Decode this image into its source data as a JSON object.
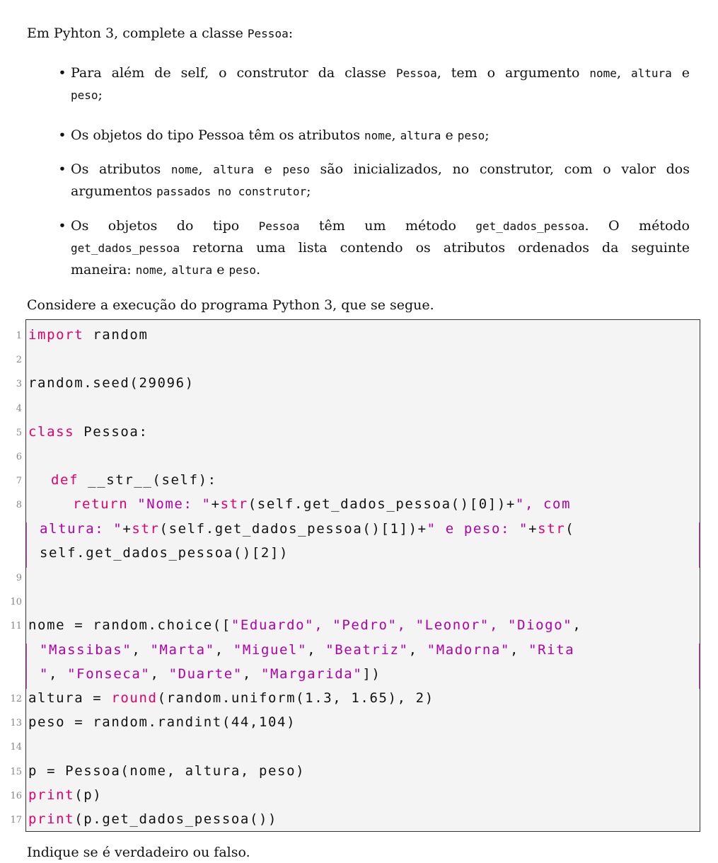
{
  "intro": {
    "text_before": "Em Pyhton 3, complete a classe ",
    "class_name": "Pessoa",
    "text_after": ":"
  },
  "bullets": [
    {
      "line1": [
        {
          "t": "Para além de self, o construtor da classe ",
          "m": false
        },
        {
          "t": "Pessoa",
          "m": true
        },
        {
          "t": ", tem o argumento ",
          "m": false
        },
        {
          "t": "nome",
          "m": true
        },
        {
          "t": ", ",
          "m": false
        },
        {
          "t": "altura",
          "m": true
        },
        {
          "t": " e",
          "m": false
        }
      ],
      "line2": [
        {
          "t": "peso",
          "m": true
        },
        {
          "t": ";",
          "m": false
        }
      ]
    },
    {
      "line1": [
        {
          "t": "Os objetos do tipo Pessoa têm os atributos ",
          "m": false
        },
        {
          "t": "nome",
          "m": true
        },
        {
          "t": ", ",
          "m": false
        },
        {
          "t": "altura",
          "m": true
        },
        {
          "t": " e ",
          "m": false
        },
        {
          "t": "peso",
          "m": true
        },
        {
          "t": ";",
          "m": false
        }
      ]
    },
    {
      "line1": [
        {
          "t": "Os atributos ",
          "m": false
        },
        {
          "t": "nome",
          "m": true
        },
        {
          "t": ", ",
          "m": false
        },
        {
          "t": "altura",
          "m": true
        },
        {
          "t": " e ",
          "m": false
        },
        {
          "t": "peso",
          "m": true
        },
        {
          "t": " são inicializados, no construtor, com o valor dos",
          "m": false
        }
      ],
      "line2": [
        {
          "t": "argumentos ",
          "m": false
        },
        {
          "t": "passados no construtor",
          "m": true
        },
        {
          "t": ";",
          "m": false
        }
      ]
    },
    {
      "line1": [
        {
          "t": "Os objetos do tipo ",
          "m": false
        },
        {
          "t": "Pessoa",
          "m": true
        },
        {
          "t": " têm um método ",
          "m": false
        },
        {
          "t": "get_dados_pessoa",
          "m": true
        },
        {
          "t": ". O método",
          "m": false
        }
      ],
      "line2": [
        {
          "t": "get_dados_pessoa",
          "m": true
        },
        {
          "t": " retorna uma lista contendo os atributos ordenados da seguinte",
          "m": false
        }
      ],
      "line3": [
        {
          "t": "maneira: ",
          "m": false
        },
        {
          "t": "nome",
          "m": true
        },
        {
          "t": ", ",
          "m": false
        },
        {
          "t": "altura",
          "m": true
        },
        {
          "t": " e ",
          "m": false
        },
        {
          "t": "peso",
          "m": true
        },
        {
          "t": ".",
          "m": false
        }
      ]
    }
  ],
  "consider_text": "Considere a execução do programa Python 3, que se segue.",
  "line_numbers": [
    "1",
    "2",
    "3",
    "4",
    "5",
    "6",
    "7",
    "8",
    "9",
    "10",
    "11",
    "12",
    "13",
    "14",
    "15",
    "16",
    "17"
  ],
  "code": {
    "l1": {
      "kw": "import",
      "rest": " random"
    },
    "l3": "random.seed(29096)",
    "l5": {
      "kw": "class",
      "rest": " Pessoa:"
    },
    "l7": {
      "kw": "def",
      "rest": " __str__(self):"
    },
    "l8a": {
      "kw": "return",
      "s1": " \"Nome: \"",
      "p1": "+",
      "f1": "str",
      "p2": "(self.get_dados_pessoa()[0])+",
      "s2": "\", com"
    },
    "l8b": {
      "s3": "altura: \"",
      "p3": "+",
      "f2": "str",
      "p4": "(self.get_dados_pessoa()[1])+",
      "s4": "\" e peso: \"",
      "p5": "+",
      "f3": "str",
      "p6": "("
    },
    "l8c": "self.get_dados_pessoa()[2])",
    "l11a": {
      "p": "nome = random.choice([",
      "s": "\"Eduardo\", \"Pedro\", \"Leonor\", \"Diogo\"",
      "e": ","
    },
    "l11b": {
      "s1": "\"Massibas\"",
      "c1": ", ",
      "s2": "\"Marta\"",
      "c2": ", ",
      "s3": "\"Miguel\"",
      "c3": ", ",
      "s4": "\"Beatriz\"",
      "c4": ", ",
      "s5": "\"Madorna\"",
      "c5": ", ",
      "s6": "\"Rita"
    },
    "l11c": {
      "s1": "\"",
      "c1": ", ",
      "s2": "\"Fonseca\"",
      "c2": ", ",
      "s3": "\"Duarte\"",
      "c3": ", ",
      "s4": "\"Margarida\"",
      "e": "])"
    },
    "l12": {
      "a": "altura = ",
      "f": "round",
      "b": "(random.uniform(1.3, 1.65), 2)"
    },
    "l13": "peso = random.randint(44,104)",
    "l15": "p = Pessoa(nome, altura, peso)",
    "l16": {
      "f": "print",
      "r": "(p)"
    },
    "l17": {
      "f": "print",
      "r": "(p.get_dados_pessoa())"
    }
  },
  "closing_text": "Indique se é verdadeiro ou falso."
}
